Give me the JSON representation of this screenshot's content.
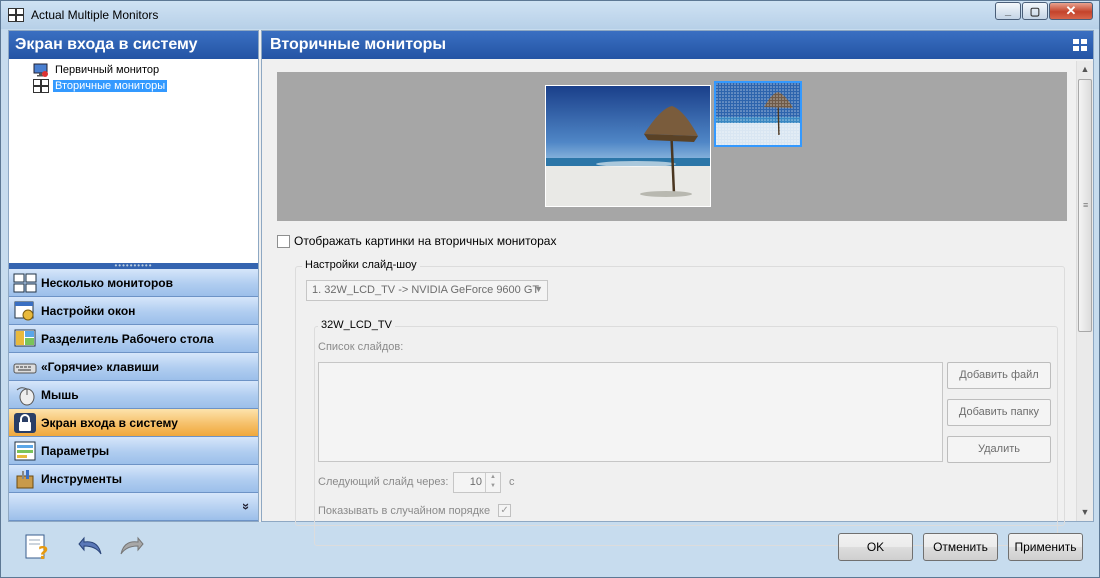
{
  "window": {
    "title": "Actual Multiple Monitors",
    "buttons": [
      "_",
      "▢",
      "✕"
    ]
  },
  "left_panel": {
    "header": "Экран входа в систему",
    "tree": [
      {
        "label": "Первичный монитор",
        "icon": "primary-monitor-icon",
        "selected": false
      },
      {
        "label": "Вторичные мониторы",
        "icon": "secondary-monitors-icon",
        "selected": true
      }
    ],
    "nav": [
      {
        "label": "Несколько мониторов",
        "icon": "multi-monitor-icon"
      },
      {
        "label": "Настройки окон",
        "icon": "window-settings-icon"
      },
      {
        "label": "Разделитель Рабочего стола",
        "icon": "desktop-divider-icon"
      },
      {
        "label": "«Горячие» клавиши",
        "icon": "keyboard-icon"
      },
      {
        "label": "Мышь",
        "icon": "mouse-icon"
      },
      {
        "label": "Экран входа в систему",
        "icon": "lock-icon",
        "active": true
      },
      {
        "label": "Параметры",
        "icon": "parameters-icon"
      },
      {
        "label": "Инструменты",
        "icon": "tools-icon"
      }
    ],
    "more": "»"
  },
  "content": {
    "header": "Вторичные мониторы",
    "show_pictures_label": "Отображать картинки на вторичных мониторах",
    "slideshow_group": "Настройки слайд-шоу",
    "monitor_select": "1. 32W_LCD_TV -> NVIDIA GeForce 9600 GT",
    "monitor_group": "32W_LCD_TV",
    "slide_list_label": "Список слайдов:",
    "add_file": "Добавить файл",
    "add_folder": "Добавить папку",
    "delete": "Удалить",
    "next_slide_label": "Следующий слайд через:",
    "next_slide_value": "10",
    "next_slide_unit": "с",
    "random_order_label": "Показывать в случайном порядке"
  },
  "footer": {
    "ok": "OK",
    "cancel": "Отменить",
    "apply": "Применить"
  },
  "colors": {
    "header_blue": "#2454a4",
    "nav_blue": "#b0cdf0",
    "nav_active": "#f6c06a",
    "selection": "#3399ff"
  }
}
